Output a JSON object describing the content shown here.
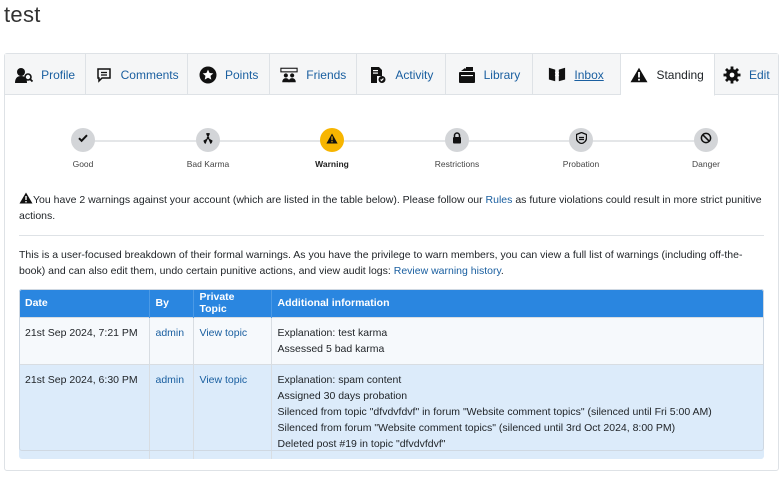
{
  "page": {
    "title": "test"
  },
  "tabs": [
    {
      "label": "Profile",
      "icon": "user-search-icon"
    },
    {
      "label": "Comments",
      "icon": "comment-icon"
    },
    {
      "label": "Points",
      "icon": "star-icon"
    },
    {
      "label": "Friends",
      "icon": "friends-icon"
    },
    {
      "label": "Activity",
      "icon": "activity-icon"
    },
    {
      "label": "Library",
      "icon": "library-icon"
    },
    {
      "label": "Inbox",
      "icon": "inbox-icon"
    },
    {
      "label": "Standing",
      "icon": "warning-icon"
    },
    {
      "label": "Edit",
      "icon": "gear-icon"
    }
  ],
  "standing": {
    "steps": [
      {
        "label": "Good",
        "icon": "check-icon"
      },
      {
        "label": "Bad Karma",
        "icon": "karma-icon"
      },
      {
        "label": "Warning",
        "icon": "warning-icon"
      },
      {
        "label": "Restrictions",
        "icon": "lock-icon"
      },
      {
        "label": "Probation",
        "icon": "shield-icon"
      },
      {
        "label": "Danger",
        "icon": "ban-icon"
      }
    ],
    "active_step": "Warning",
    "active_color": "#f7b500"
  },
  "warning": {
    "before": "You have 2 warnings against your account (which are listed in the table below). Please follow our ",
    "link": "Rules",
    "after": " as future violations could result in more strict punitive actions."
  },
  "info": {
    "before": "This is a user-focused breakdown of their formal warnings. As you have the privilege to warn members, you can view a full list of warnings (including off-the-book) and can also edit them, undo certain punitive actions, and view audit logs: ",
    "link": "Review warning history",
    "after": "."
  },
  "table": {
    "headers": [
      "Date",
      "By",
      "Private Topic",
      "Additional information"
    ],
    "header_color": "#2a86e0",
    "rows": [
      {
        "date": "21st Sep 2024, 7:21 PM",
        "by": "admin",
        "topic": "View topic",
        "lines": [
          "Explanation: test karma",
          "Assessed 5 bad karma"
        ]
      },
      {
        "date": "21st Sep 2024, 6:30 PM",
        "by": "admin",
        "topic": "View topic",
        "lines": [
          "Explanation: spam content",
          "Assigned 30 days probation",
          "Silenced from topic \"dfvdvfdvf\" in forum \"Website comment topics\" (silenced until Fri 5:00 AM)",
          "Silenced from forum \"Website comment topics\" (silenced until 3rd Oct 2024, 8:00 PM)",
          "Deleted post #19 in topic \"dfvdvfdvf\""
        ]
      }
    ]
  }
}
